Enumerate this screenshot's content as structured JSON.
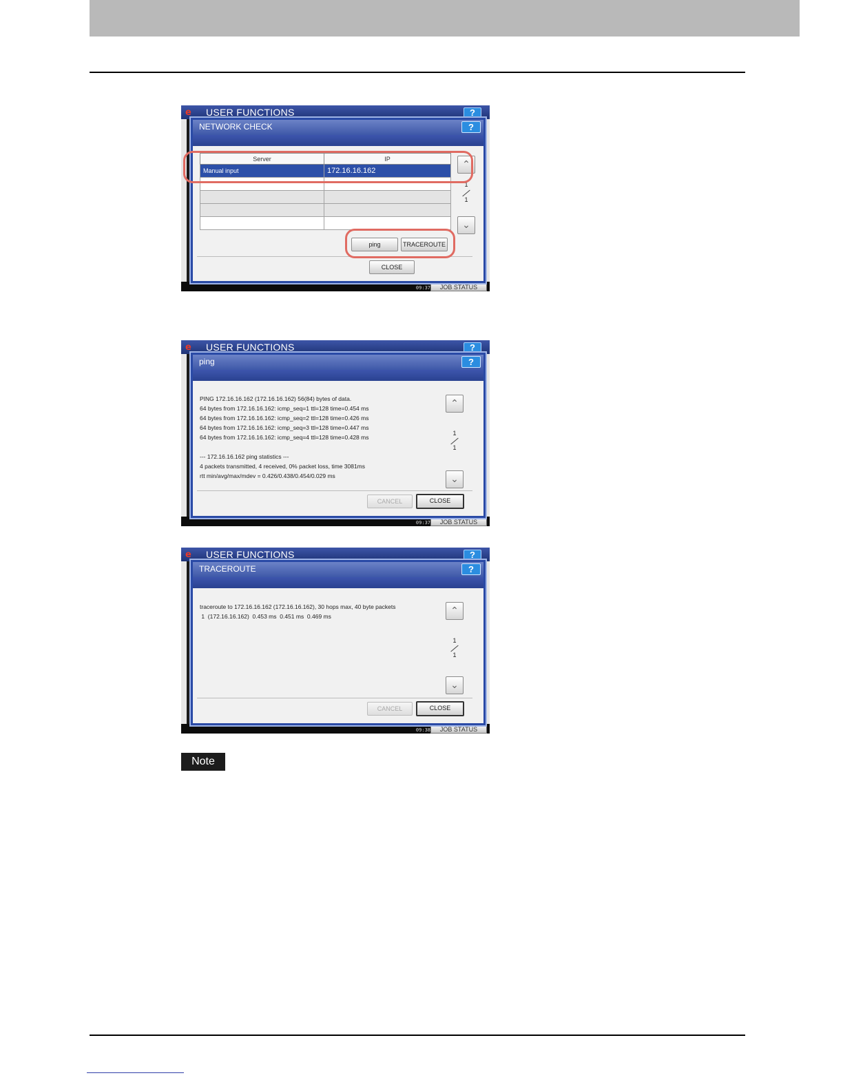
{
  "common": {
    "logo": "e",
    "uf_title": "USER FUNCTIONS",
    "help": "?",
    "job_status": "JOB STATUS",
    "page_current": "1",
    "page_total": "1",
    "close": "CLOSE",
    "cancel": "CANCEL"
  },
  "screen1": {
    "dialog_title": "NETWORK CHECK",
    "time": "09:37",
    "columns": [
      "Server",
      "IP"
    ],
    "rows": [
      {
        "server": "Manual input",
        "ip": "172.16.16.162"
      },
      {
        "server": "",
        "ip": ""
      },
      {
        "server": "",
        "ip": ""
      },
      {
        "server": "",
        "ip": ""
      },
      {
        "server": "",
        "ip": ""
      }
    ],
    "ping_label": "ping",
    "traceroute_label": "TRACEROUTE"
  },
  "screen2": {
    "dialog_title": "ping",
    "time": "09:37",
    "lines": [
      "PING 172.16.16.162 (172.16.16.162) 56(84) bytes of data.",
      "64 bytes from 172.16.16.162: icmp_seq=1 ttl=128 time=0.454 ms",
      "64 bytes from 172.16.16.162: icmp_seq=2 ttl=128 time=0.426 ms",
      "64 bytes from 172.16.16.162: icmp_seq=3 ttl=128 time=0.447 ms",
      "64 bytes from 172.16.16.162: icmp_seq=4 ttl=128 time=0.428 ms",
      "",
      "--- 172.16.16.162 ping statistics ---",
      "4 packets transmitted, 4 received, 0% packet loss, time 3081ms",
      "rtt min/avg/max/mdev = 0.426/0.438/0.454/0.029 ms"
    ]
  },
  "screen3": {
    "dialog_title": "TRACEROUTE",
    "time": "09:38",
    "lines": [
      "traceroute to 172.16.16.162 (172.16.16.162), 30 hops max, 40 byte packets",
      " 1  (172.16.16.162)  0.453 ms  0.451 ms  0.469 ms"
    ]
  },
  "note_label": "Note"
}
